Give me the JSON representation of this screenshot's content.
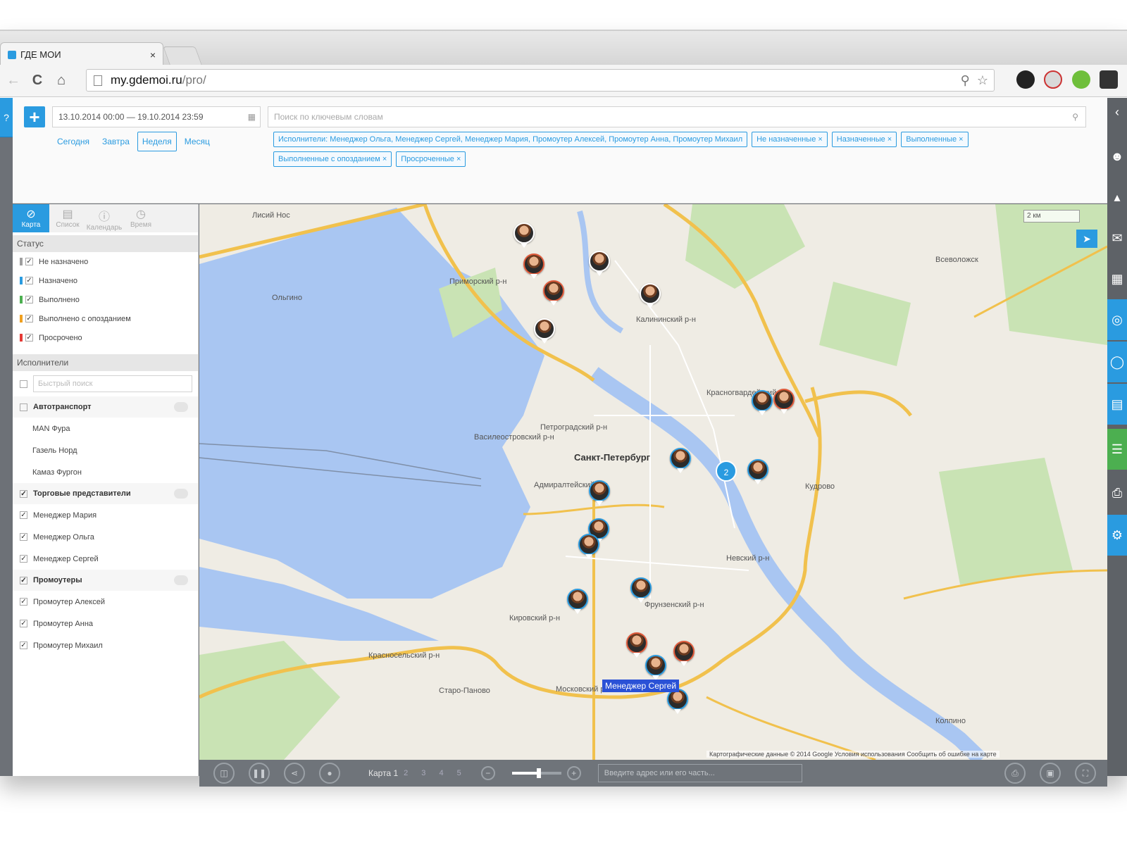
{
  "browser": {
    "tab_title": "ГДЕ МОИ",
    "tab_close": "×",
    "url_host": "my.gdemoi.ru",
    "url_path": "/pro/",
    "back": "←",
    "reload": "C",
    "home": "⌂"
  },
  "toolbar": {
    "add_label": "+",
    "date_range": "13.10.2014 00:00 — 19.10.2014 23:59",
    "search_placeholder": "Поиск по ключевым словам",
    "periods": [
      "Сегодня",
      "Завтра",
      "Неделя",
      "Месяц"
    ],
    "active_period": "Неделя",
    "filters": [
      "Исполнители: Менеджер Ольга, Менеджер Сергей, Менеджер Мария, Промоутер Алексей, Промоутер Анна, Промоутер Михаил",
      "Не назначенные ×",
      "Назначенные ×",
      "Выполненные ×",
      "Выполненные с опозданием ×",
      "Просроченные ×"
    ]
  },
  "sidebar": {
    "tabs": [
      {
        "label": "Карта",
        "icon": "map-icon"
      },
      {
        "label": "Список",
        "icon": "list-icon"
      },
      {
        "label": "Календарь",
        "icon": "calendar-icon"
      },
      {
        "label": "Время",
        "icon": "clock-icon"
      }
    ],
    "status_title": "Статус",
    "statuses": [
      {
        "label": "Не назначено",
        "color": "#9e9e9e"
      },
      {
        "label": "Назначено",
        "color": "#2a9be0"
      },
      {
        "label": "Выполнено",
        "color": "#4caf50"
      },
      {
        "label": "Выполнено с опозданием",
        "color": "#f0a020"
      },
      {
        "label": "Просрочено",
        "color": "#e53935"
      }
    ],
    "executors_title": "Исполнители",
    "quick_search_placeholder": "Быстрый поиск",
    "groups": [
      {
        "name": "Автотранспорт",
        "checked": false,
        "members": [
          "MAN Фура",
          "Газель Норд",
          "Камаз Фургон"
        ]
      },
      {
        "name": "Торговые представители",
        "checked": true,
        "members": [
          "Менеджер Мария",
          "Менеджер Ольга",
          "Менеджер Сергей"
        ]
      },
      {
        "name": "Промоутеры",
        "checked": true,
        "members": [
          "Промоутер Алексей",
          "Промоутер Анна",
          "Промоутер Михаил"
        ]
      }
    ]
  },
  "map": {
    "labels": [
      "Приморский р-н",
      "Калининский р-н",
      "Красногвардейский р-н",
      "Василеостровский р-н",
      "Петроградский р-н",
      "Санкт-Петербург",
      "Адмиралтейский р-н",
      "Невский р-н",
      "Фрунзенский р-н",
      "Кировский р-н",
      "Красносельский р-н",
      "Московский р-н",
      "Всеволожск",
      "Лисий Нос",
      "Ольгино",
      "Старо-Паново",
      "Кудрово",
      "Колпино"
    ],
    "cluster_count": "2",
    "tooltip": "Менеджер Сергей",
    "scale": "2 км",
    "copyright": "Картографические данные © 2014 Google   Условия использования   Сообщить об ошибке на карте"
  },
  "bottombar": {
    "page_label": "Карта 1",
    "page_numbers": "2 3 4 5",
    "zoom_value": 0.55,
    "address_placeholder": "Введите адрес или его часть..."
  },
  "colors": {
    "accent": "#2a9be0",
    "water": "#a9c6f2",
    "park": "#c9e3b4",
    "road_major": "#f1c14d",
    "rail": "#5e6267"
  }
}
